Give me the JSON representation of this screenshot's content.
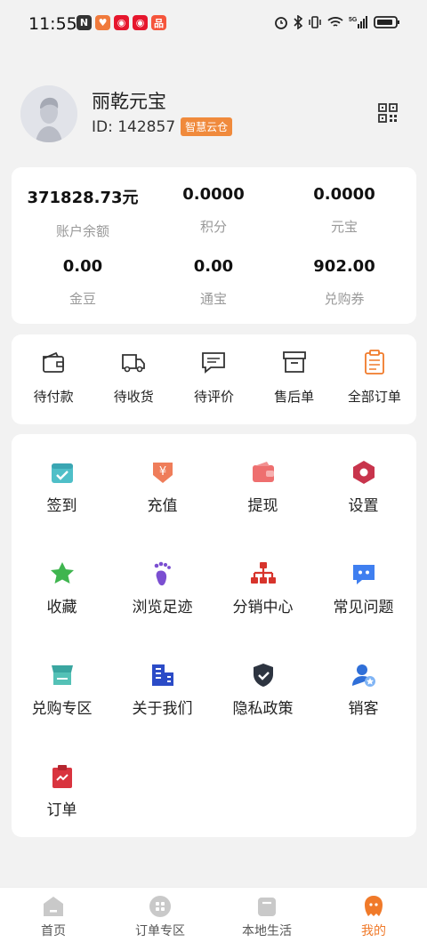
{
  "status_bar": {
    "time": "11:55",
    "network": "5G"
  },
  "profile": {
    "name": "丽乾元宝",
    "id_text": "ID: 142857",
    "badge": "智慧云仓",
    "qr_icon": "qr-code-icon"
  },
  "balances": [
    {
      "value": "371828.73元",
      "label": "账户余额"
    },
    {
      "value": "0.0000",
      "label": "积分"
    },
    {
      "value": "0.0000",
      "label": "元宝"
    },
    {
      "value": "0.00",
      "label": "金豆"
    },
    {
      "value": "0.00",
      "label": "通宝"
    },
    {
      "value": "902.00",
      "label": "兑购券"
    }
  ],
  "orders": [
    {
      "label": "待付款",
      "icon": "wallet-icon"
    },
    {
      "label": "待收货",
      "icon": "truck-icon"
    },
    {
      "label": "待评价",
      "icon": "comment-icon"
    },
    {
      "label": "售后单",
      "icon": "box-icon"
    },
    {
      "label": "全部订单",
      "icon": "clipboard-icon"
    }
  ],
  "menu": [
    {
      "label": "签到",
      "icon": "calendar-check-icon"
    },
    {
      "label": "充值",
      "icon": "yen-recharge-icon"
    },
    {
      "label": "提现",
      "icon": "wallet-icon"
    },
    {
      "label": "设置",
      "icon": "settings-hex-icon"
    },
    {
      "label": "收藏",
      "icon": "star-icon"
    },
    {
      "label": "浏览足迹",
      "icon": "footprint-icon"
    },
    {
      "label": "分销中心",
      "icon": "hierarchy-icon"
    },
    {
      "label": "常见问题",
      "icon": "chat-icon"
    },
    {
      "label": "兑购专区",
      "icon": "store-icon"
    },
    {
      "label": "关于我们",
      "icon": "building-icon"
    },
    {
      "label": "隐私政策",
      "icon": "shield-icon"
    },
    {
      "label": "销客",
      "icon": "user-badge-icon"
    },
    {
      "label": "订单",
      "icon": "order-clipboard-icon"
    }
  ],
  "tabs": [
    {
      "label": "首页",
      "icon": "home-icon",
      "active": false
    },
    {
      "label": "订单专区",
      "icon": "grid-icon",
      "active": false
    },
    {
      "label": "本地生活",
      "icon": "bag-icon",
      "active": false
    },
    {
      "label": "我的",
      "icon": "profile-icon",
      "active": true
    }
  ],
  "colors": {
    "accent": "#f07a2a",
    "badge": "#f08a3c",
    "background": "#f2f2f2"
  }
}
